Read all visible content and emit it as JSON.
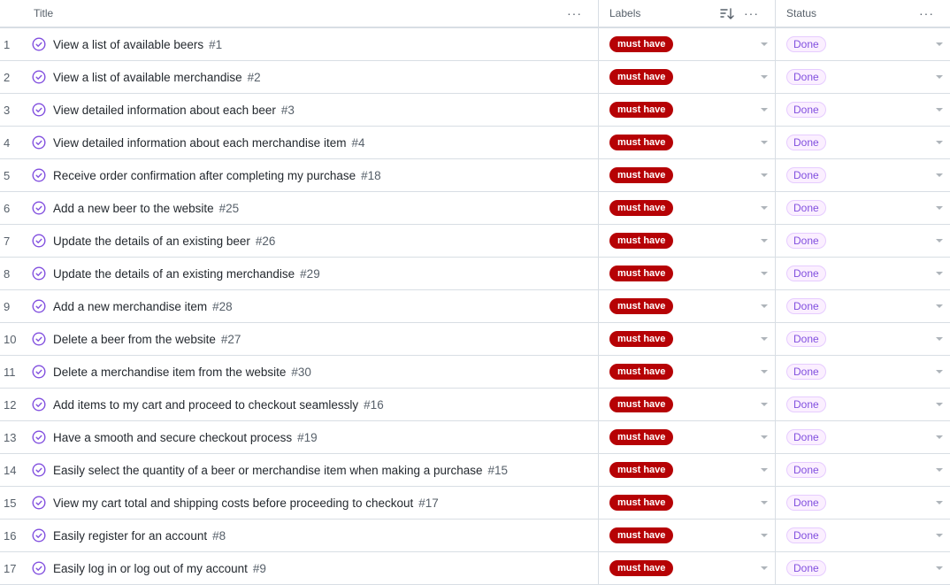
{
  "header": {
    "title_label": "Title",
    "labels_label": "Labels",
    "status_label": "Status",
    "menu_glyph": "···"
  },
  "colors": {
    "must_have": "#b60205",
    "done_bg": "#fbefff",
    "done_text": "#8250df",
    "done_icon": "#8250df"
  },
  "rows": [
    {
      "num": "1",
      "title": "View a list of available beers",
      "issue": "#1",
      "label": "must have",
      "status": "Done"
    },
    {
      "num": "2",
      "title": "View a list of available merchandise",
      "issue": "#2",
      "label": "must have",
      "status": "Done"
    },
    {
      "num": "3",
      "title": "View detailed information about each beer",
      "issue": "#3",
      "label": "must have",
      "status": "Done"
    },
    {
      "num": "4",
      "title": "View detailed information about each merchandise item",
      "issue": "#4",
      "label": "must have",
      "status": "Done"
    },
    {
      "num": "5",
      "title": "Receive order confirmation after completing my purchase",
      "issue": "#18",
      "label": "must have",
      "status": "Done"
    },
    {
      "num": "6",
      "title": "Add a new beer to the website",
      "issue": "#25",
      "label": "must have",
      "status": "Done"
    },
    {
      "num": "7",
      "title": "Update the details of an existing beer",
      "issue": "#26",
      "label": "must have",
      "status": "Done"
    },
    {
      "num": "8",
      "title": "Update the details of an existing merchandise",
      "issue": "#29",
      "label": "must have",
      "status": "Done"
    },
    {
      "num": "9",
      "title": "Add a new merchandise item",
      "issue": "#28",
      "label": "must have",
      "status": "Done"
    },
    {
      "num": "10",
      "title": "Delete a beer from the website",
      "issue": "#27",
      "label": "must have",
      "status": "Done"
    },
    {
      "num": "11",
      "title": "Delete a merchandise item from the website",
      "issue": "#30",
      "label": "must have",
      "status": "Done"
    },
    {
      "num": "12",
      "title": "Add items to my cart and proceed to checkout seamlessly",
      "issue": "#16",
      "label": "must have",
      "status": "Done"
    },
    {
      "num": "13",
      "title": "Have a smooth and secure checkout process",
      "issue": "#19",
      "label": "must have",
      "status": "Done"
    },
    {
      "num": "14",
      "title": "Easily select the quantity of a beer or merchandise item when making a purchase",
      "issue": "#15",
      "label": "must have",
      "status": "Done"
    },
    {
      "num": "15",
      "title": "View my cart total and shipping costs before proceeding to checkout",
      "issue": "#17",
      "label": "must have",
      "status": "Done"
    },
    {
      "num": "16",
      "title": "Easily register for an account",
      "issue": "#8",
      "label": "must have",
      "status": "Done"
    },
    {
      "num": "17",
      "title": "Easily log in or log out of my account",
      "issue": "#9",
      "label": "must have",
      "status": "Done"
    }
  ]
}
